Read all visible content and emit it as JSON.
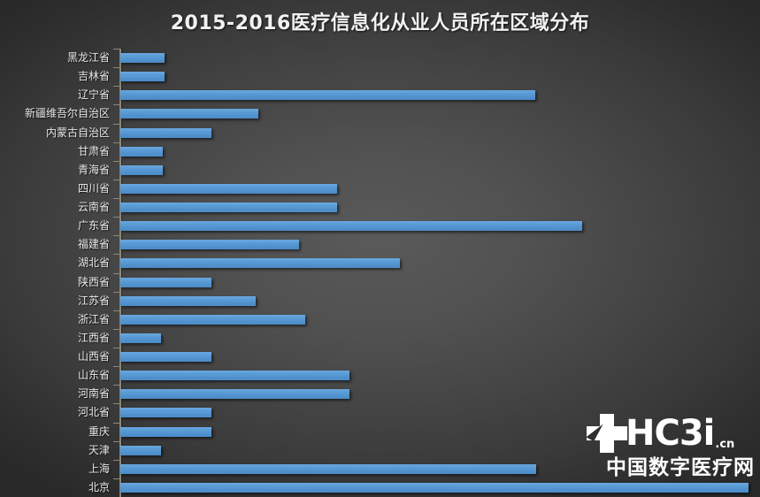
{
  "chart": {
    "title": "2015-2016医疗信息化从业人员所在区域分布"
  },
  "watermark": {
    "brand": "HC3i",
    "tld": ".cn",
    "subtitle": "中国数字医疗网",
    "cross_icon": "medical-cross-icon"
  },
  "colors": {
    "bar": "#5B9BD5",
    "background_center": "#5a5a5a",
    "background_edge": "#2b2b2b",
    "axis": "#8d8878",
    "label_text": "#e8e8e8",
    "title_text": "#f2f2f2"
  },
  "chart_data": {
    "type": "bar",
    "orientation": "horizontal",
    "title": "2015-2016医疗信息化从业人员所在区域分布",
    "xlabel": "",
    "ylabel": "",
    "grid": false,
    "legend": false,
    "axis_ticks_visible": true,
    "value_labels_visible": false,
    "xlim": [
      0,
      100
    ],
    "categories": [
      "黑龙江省",
      "吉林省",
      "辽宁省",
      "新疆维吾尔自治区",
      "内蒙古自治区",
      "甘肃省",
      "青海省",
      "四川省",
      "云南省",
      "广东省",
      "福建省",
      "湖北省",
      "陕西省",
      "江苏省",
      "浙江省",
      "江西省",
      "山西省",
      "山东省",
      "河南省",
      "河北省",
      "重庆",
      "天津",
      "上海",
      "北京"
    ],
    "values": [
      7.0,
      7.0,
      66.0,
      22.0,
      14.5,
      6.8,
      6.8,
      34.5,
      34.5,
      73.5,
      28.5,
      44.5,
      14.5,
      21.5,
      29.5,
      6.5,
      14.5,
      36.5,
      36.5,
      14.5,
      14.5,
      6.5,
      66.2,
      100.0
    ]
  }
}
